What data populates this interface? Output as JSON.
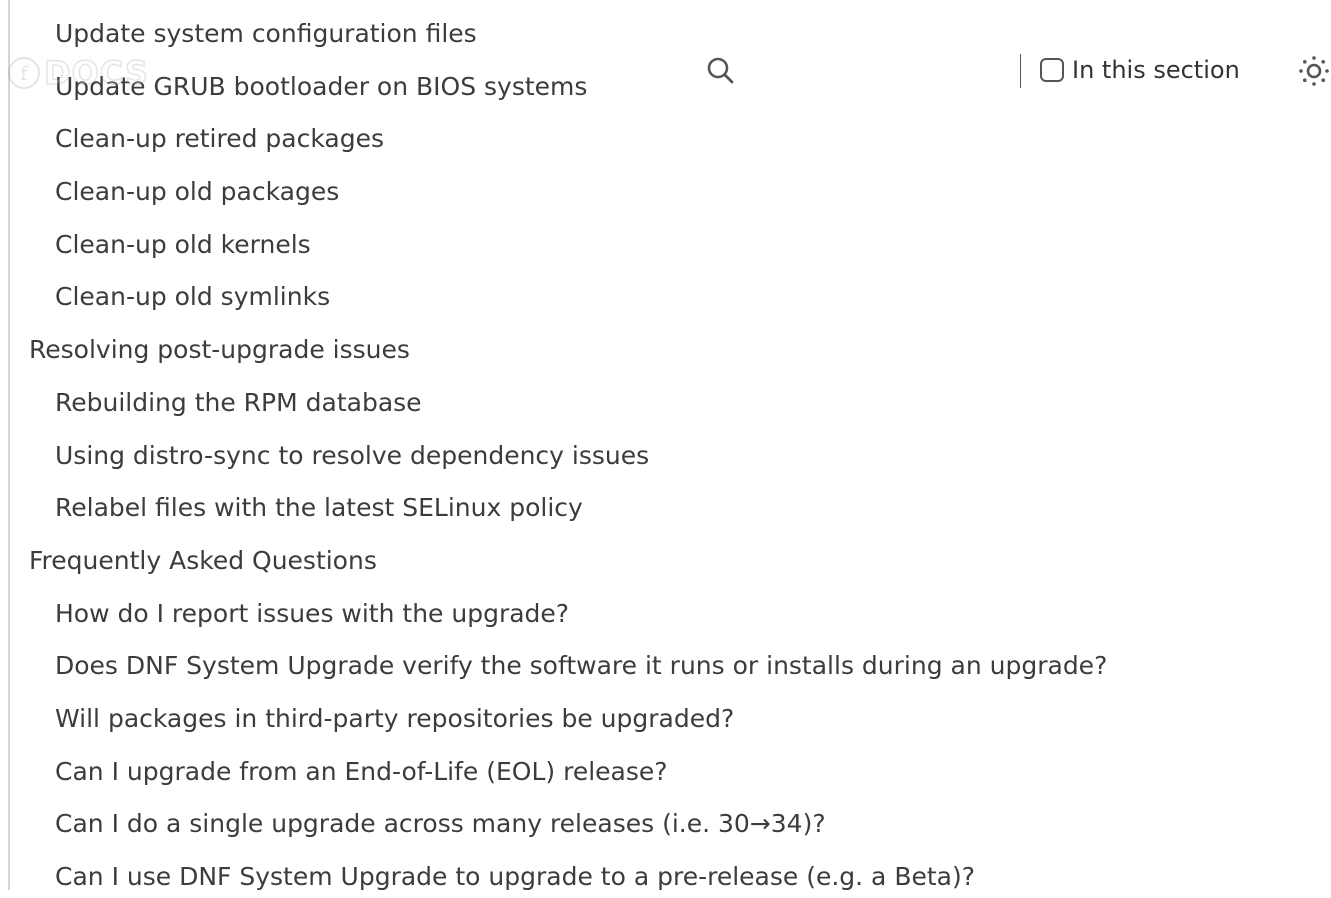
{
  "header": {
    "logo_text": "DOCS",
    "section_toggle_label": "In this section"
  },
  "toc": {
    "items": [
      {
        "level": 2,
        "label": "Update system configuration files"
      },
      {
        "level": 2,
        "label": "Update GRUB bootloader on BIOS systems"
      },
      {
        "level": 2,
        "label": "Clean-up retired packages"
      },
      {
        "level": 2,
        "label": "Clean-up old packages"
      },
      {
        "level": 2,
        "label": "Clean-up old kernels"
      },
      {
        "level": 2,
        "label": "Clean-up old symlinks"
      },
      {
        "level": 1,
        "label": "Resolving post-upgrade issues"
      },
      {
        "level": 2,
        "label": "Rebuilding the RPM database"
      },
      {
        "level": 2,
        "label": "Using distro-sync to resolve dependency issues"
      },
      {
        "level": 2,
        "label": "Relabel files with the latest SELinux policy"
      },
      {
        "level": 1,
        "label": "Frequently Asked Questions"
      },
      {
        "level": 2,
        "label": "How do I report issues with the upgrade?"
      },
      {
        "level": 2,
        "label": "Does DNF System Upgrade verify the software it runs or installs during an upgrade?"
      },
      {
        "level": 2,
        "label": "Will packages in third-party repositories be upgraded?"
      },
      {
        "level": 2,
        "label": "Can I upgrade from an End-of-Life (EOL) release?"
      },
      {
        "level": 2,
        "label": "Can I do a single upgrade across many releases (i.e. 30→34)?"
      },
      {
        "level": 2,
        "label": "Can I use DNF System Upgrade to upgrade to a pre-release (e.g. a Beta)?"
      }
    ]
  },
  "icons": {
    "search": "search-icon",
    "theme": "sun-icon"
  }
}
